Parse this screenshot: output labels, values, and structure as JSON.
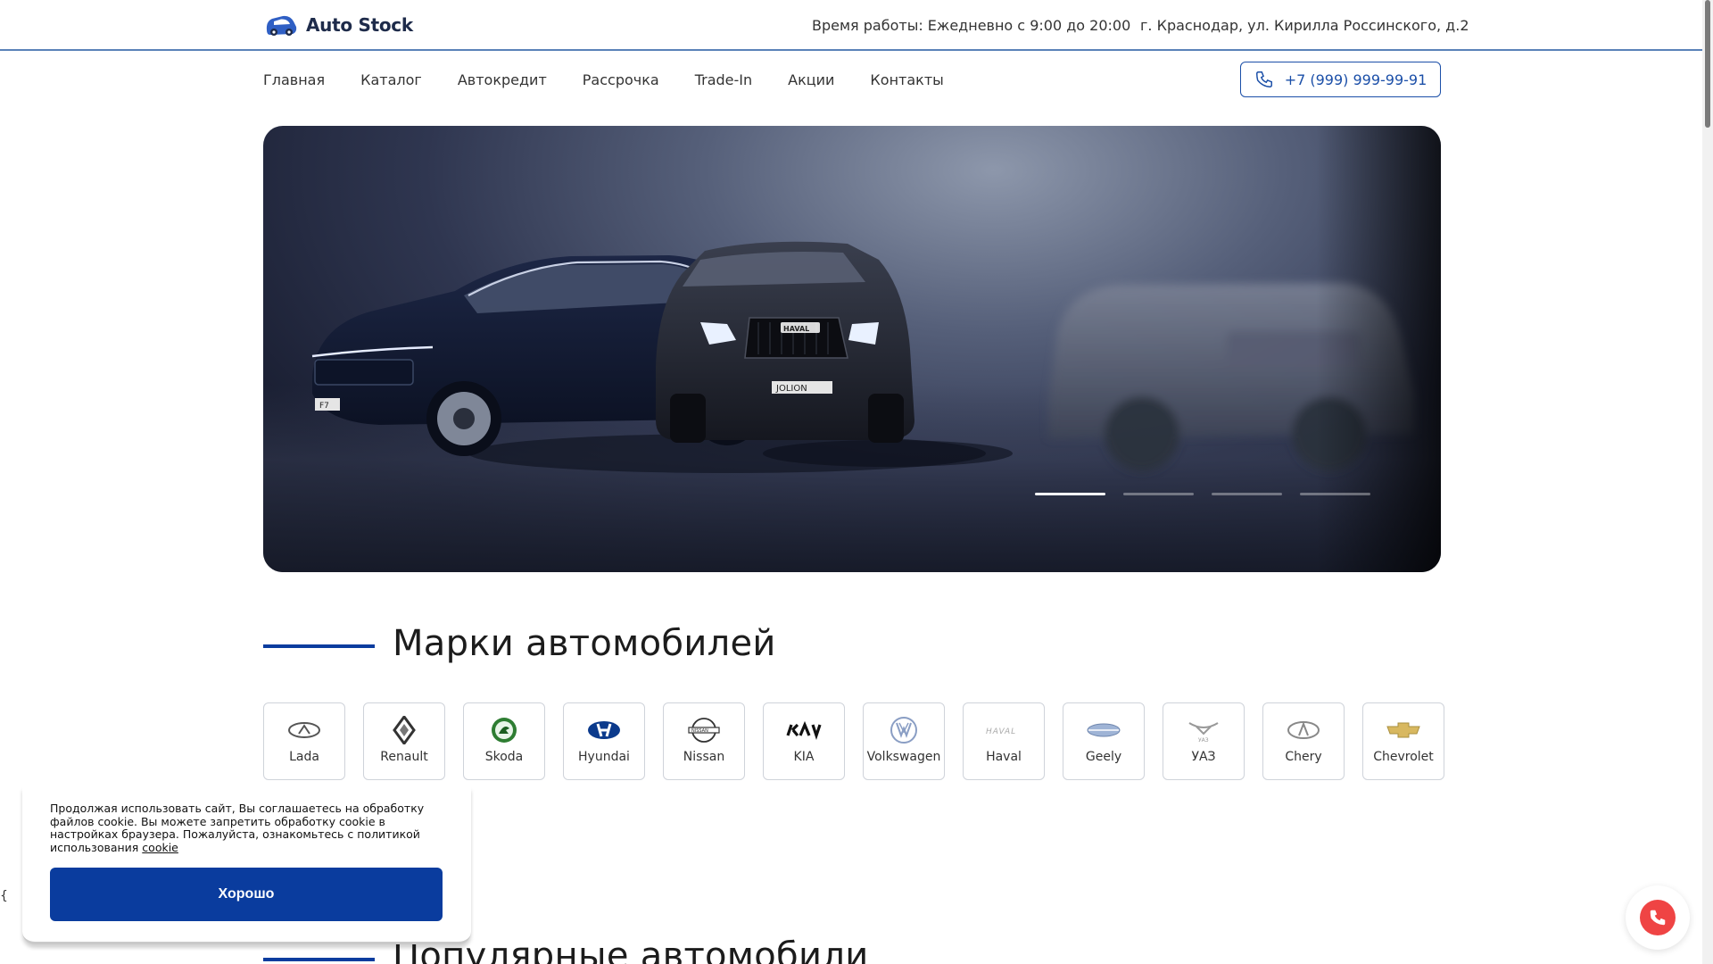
{
  "header": {
    "brand_name": "Auto Stock",
    "work_hours": "Время работы: Ежедневно с 9:00 до 20:00",
    "address": "г. Краснодар, ул. Кирилла Россинского, д.2"
  },
  "nav": {
    "items": [
      "Главная",
      "Каталог",
      "Автокредит",
      "Рассрочка",
      "Trade-In",
      "Акции",
      "Контакты"
    ],
    "phone": "+7 (999) 999-99-91"
  },
  "hero": {
    "slides_count": 4,
    "active_slide": 1,
    "plate_1": "F7",
    "badge_2": "HAVAL",
    "plate_2": "JOLION"
  },
  "brands_section": {
    "title": "Марки автомобилей",
    "brands": [
      {
        "label": "Lada",
        "icon": "lada-logo-icon"
      },
      {
        "label": "Renault",
        "icon": "renault-logo-icon"
      },
      {
        "label": "Skoda",
        "icon": "skoda-logo-icon"
      },
      {
        "label": "Hyundai",
        "icon": "hyundai-logo-icon"
      },
      {
        "label": "Nissan",
        "icon": "nissan-logo-icon"
      },
      {
        "label": "KIA",
        "icon": "kia-logo-icon"
      },
      {
        "label": "Volkswagen",
        "icon": "volkswagen-logo-icon"
      },
      {
        "label": "Haval",
        "icon": "haval-logo-icon"
      },
      {
        "label": "Geely",
        "icon": "geely-logo-icon"
      },
      {
        "label": "УАЗ",
        "icon": "uaz-logo-icon"
      },
      {
        "label": "Chery",
        "icon": "chery-logo-icon"
      },
      {
        "label": "Chevrolet",
        "icon": "chevrolet-logo-icon"
      }
    ]
  },
  "popular_section": {
    "title": "Популярные автомобили"
  },
  "cookie": {
    "text": "Продолжая использовать сайт, Вы соглашаетесь на обработку файлов cookie. Вы можете запретить обработку cookie в настройках браузера. Пожалуйста, ознакомьтесь с политикой использования",
    "link": "cookie",
    "button": "Хорошо"
  },
  "stray_char": "{",
  "colors": {
    "accent": "#0a3c9e",
    "phone_border": "#1b4fa8",
    "call_button": "#ef4444",
    "header_line": "#5a82b8"
  }
}
